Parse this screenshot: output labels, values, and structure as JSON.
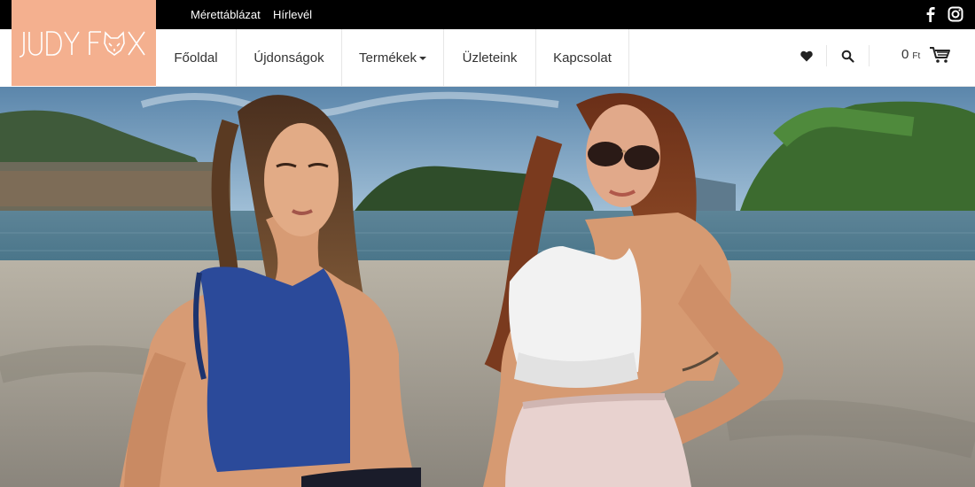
{
  "topbar": {
    "links": [
      "Mérettáblázat",
      "Hírlevél"
    ],
    "social": [
      "facebook-icon",
      "instagram-icon"
    ]
  },
  "logo": {
    "text": "JUDY FOX",
    "bg_color": "#f4b08f"
  },
  "nav": {
    "items": [
      "Főoldal",
      "Újdonságok",
      "Termékek",
      "Üzleteink",
      "Kapcsolat"
    ]
  },
  "cart": {
    "amount": "0",
    "currency": "Ft"
  },
  "icons": [
    "heart-icon",
    "search-icon",
    "cart-icon"
  ],
  "colors": {
    "topbar": "#000000",
    "accent": "#f4b08f",
    "text": "#333333"
  }
}
